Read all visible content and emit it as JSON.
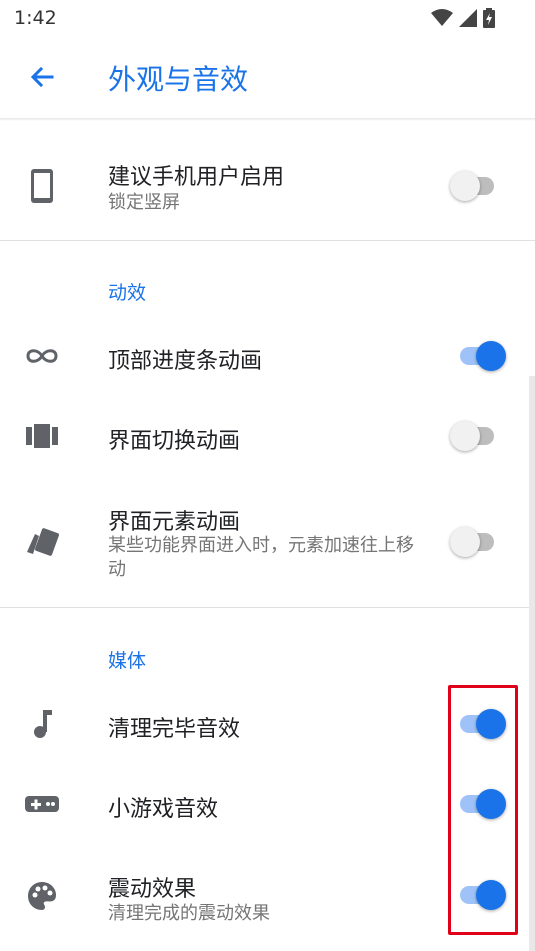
{
  "status_bar": {
    "time": "1:42"
  },
  "app_bar": {
    "title": "外观与音效"
  },
  "orientation_row": {
    "title": "建议手机用户启用",
    "subtitle": "锁定竖屏",
    "enabled": false
  },
  "sections": {
    "animation": {
      "label": "动效",
      "items": [
        {
          "title": "顶部进度条动画",
          "subtitle": "",
          "enabled": true,
          "icon": "infinity-icon"
        },
        {
          "title": "界面切换动画",
          "subtitle": "",
          "enabled": false,
          "icon": "view-carousel-icon"
        },
        {
          "title": "界面元素动画",
          "subtitle": "某些功能界面进入时，元素加速往上移动",
          "enabled": false,
          "icon": "cards-icon"
        }
      ]
    },
    "media": {
      "label": "媒体",
      "items": [
        {
          "title": "清理完毕音效",
          "subtitle": "",
          "enabled": true,
          "icon": "music-note-icon"
        },
        {
          "title": "小游戏音效",
          "subtitle": "",
          "enabled": true,
          "icon": "gamepad-icon"
        },
        {
          "title": "震动效果",
          "subtitle": "清理完成的震动效果",
          "enabled": true,
          "icon": "palette-icon"
        }
      ]
    }
  },
  "colors": {
    "accent": "#1a73e8",
    "highlight": "#e0001a",
    "icon": "#5f6368"
  }
}
